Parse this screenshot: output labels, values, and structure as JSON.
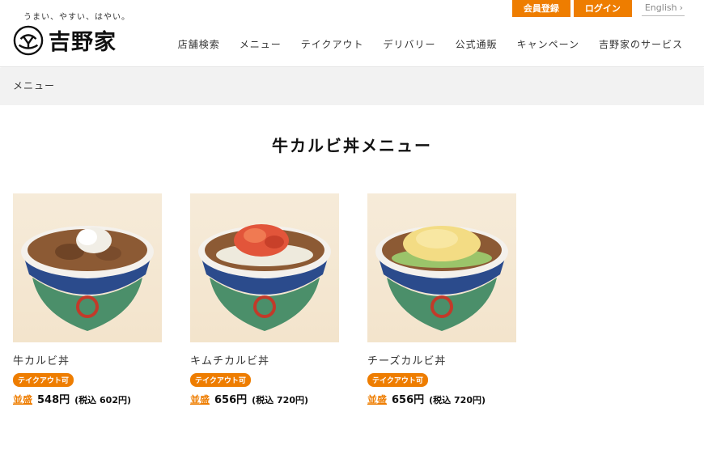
{
  "header": {
    "tagline": "うまい、やすい、はやい。",
    "logo_text": "吉野家",
    "register_label": "会員登録",
    "login_label": "ログイン",
    "english_label": "English",
    "nav": [
      "店舗検索",
      "メニュー",
      "テイクアウト",
      "デリバリー",
      "公式通販",
      "キャンペーン",
      "吉野家のサービス"
    ]
  },
  "breadcrumb": {
    "current": "メニュー"
  },
  "page_title": "牛カルビ丼メニュー",
  "accent_color": "#ee7d00",
  "products": [
    {
      "name": "牛カルビ丼",
      "badge": "テイクアウト可",
      "size": "並盛",
      "price": "548円",
      "price_tax": "(税込 602円)",
      "topping": "negi"
    },
    {
      "name": "キムチカルビ丼",
      "badge": "テイクアウト可",
      "size": "並盛",
      "price": "656円",
      "price_tax": "(税込 720円)",
      "topping": "kimchi"
    },
    {
      "name": "チーズカルビ丼",
      "badge": "テイクアウト可",
      "size": "並盛",
      "price": "656円",
      "price_tax": "(税込 720円)",
      "topping": "cheese"
    }
  ]
}
